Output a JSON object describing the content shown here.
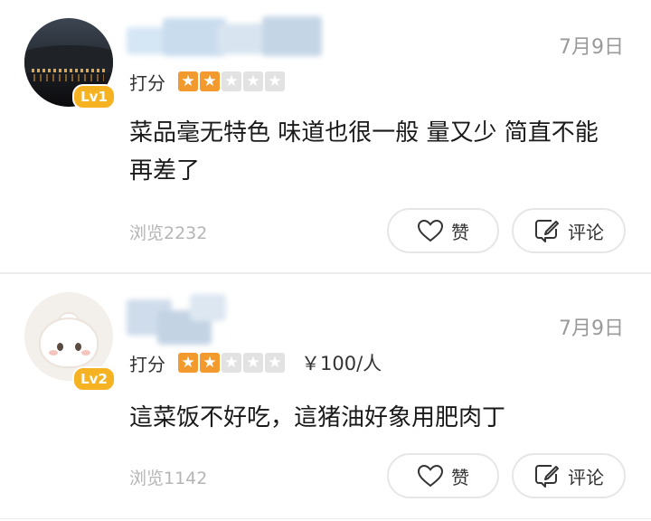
{
  "reviews": [
    {
      "date": "7月9日",
      "rating_label": "打分",
      "level": "Lv1",
      "stars_total": 5,
      "stars_filled": 2,
      "price": "",
      "comment_line1": "菜品毫无特色 味道也很一般 量又少  简直不能",
      "comment_line2": "再差了",
      "views": "浏览2232",
      "like_label": "赞",
      "comment_label": "评论"
    },
    {
      "date": "7月9日",
      "rating_label": "打分",
      "level": "Lv2",
      "stars_total": 5,
      "stars_filled": 2,
      "price": "￥100/人",
      "comment_line1": "這菜饭不好吃，這猪油好象用肥肉丁",
      "comment_line2": "",
      "views": "浏览1142",
      "like_label": "赞",
      "comment_label": "评论"
    }
  ],
  "colors": {
    "star_on": "#f39a2e",
    "star_off": "#e2e2e2",
    "level_badge": "#f5b324"
  },
  "icons": {
    "like": "heart-icon",
    "comment": "edit-comment-icon",
    "star": "star-icon"
  }
}
